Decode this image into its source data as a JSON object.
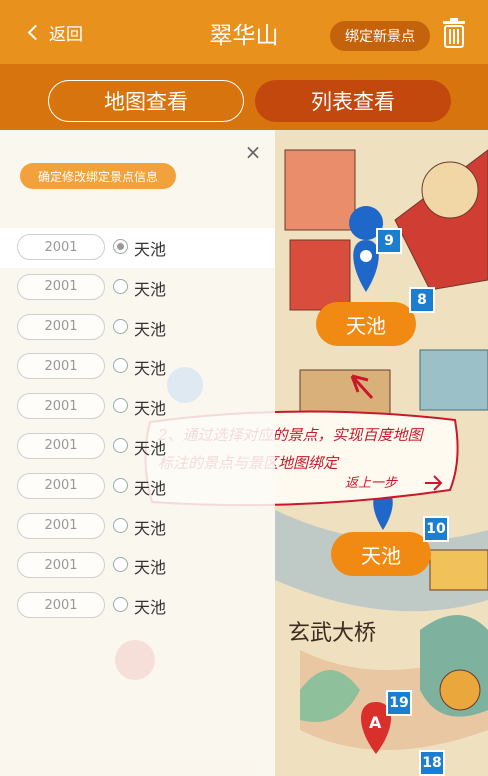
{
  "header": {
    "back_label": "返回",
    "title": "翠华山",
    "bind_button": "绑定新景点"
  },
  "tabs": {
    "map": "地图查看",
    "list": "列表查看"
  },
  "panel": {
    "close": "×",
    "confirm_button": "确定修改绑定景点信息",
    "rows": [
      {
        "code": "2001",
        "label": "天池",
        "selected": true
      },
      {
        "code": "2001",
        "label": "天池",
        "selected": false
      },
      {
        "code": "2001",
        "label": "天池",
        "selected": false
      },
      {
        "code": "2001",
        "label": "天池",
        "selected": false
      },
      {
        "code": "2001",
        "label": "天池",
        "selected": false
      },
      {
        "code": "2001",
        "label": "天池",
        "selected": false
      },
      {
        "code": "2001",
        "label": "天池",
        "selected": false
      },
      {
        "code": "2001",
        "label": "天池",
        "selected": false
      },
      {
        "code": "2001",
        "label": "天池",
        "selected": false
      },
      {
        "code": "2001",
        "label": "天池",
        "selected": false
      }
    ]
  },
  "map": {
    "spot_top": "天池",
    "spot_bottom": "天池",
    "badges": [
      "9",
      "8",
      "10",
      "19",
      "18"
    ],
    "pin_letter": "A",
    "bridge_text": "玄武大桥"
  },
  "annotation": {
    "line1": "2、通过选择对应的景点，实现百度地图",
    "line2": "标注的景点与景区地图绑定",
    "line3": "返上一步"
  },
  "colors": {
    "header": "#e8911d",
    "tabbar": "#d8740e",
    "accent": "#f08a12",
    "badge": "#1c7ed0",
    "annotation": "#c8182a"
  }
}
